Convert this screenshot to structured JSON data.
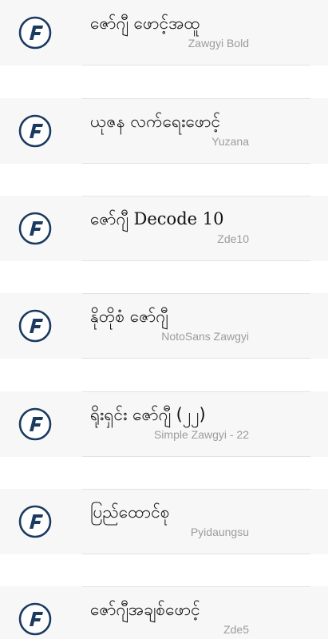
{
  "fonts": [
    {
      "title": "ဇော်ဂျီ ဖောင့်အထူ",
      "subtitle": "Zawgyi Bold"
    },
    {
      "title": "ယုဇန လက်ရေးဖောင့်",
      "subtitle": "Yuzana"
    },
    {
      "title": "ဇော်ဂျီ Decode 10",
      "subtitle": "Zde10"
    },
    {
      "title": "နိုတိုစံ ဇော်ဂျီ",
      "subtitle": "NotoSans Zawgyi"
    },
    {
      "title": "ရိုးရှင်း ဇော်ဂျီ (၂၂)",
      "subtitle": "Simple Zawgyi - 22"
    },
    {
      "title": "ပြည်ထောင်စု",
      "subtitle": "Pyidaungsu"
    },
    {
      "title": "ဇော်ဂျီအချစ်ဖောင့်",
      "subtitle": "Zde5"
    }
  ],
  "icon": "font-f-logo-icon",
  "colors": {
    "item_background": "#f7f7f7",
    "logo_navy": "#1b3a60",
    "subtitle": "#9c9c9c"
  }
}
